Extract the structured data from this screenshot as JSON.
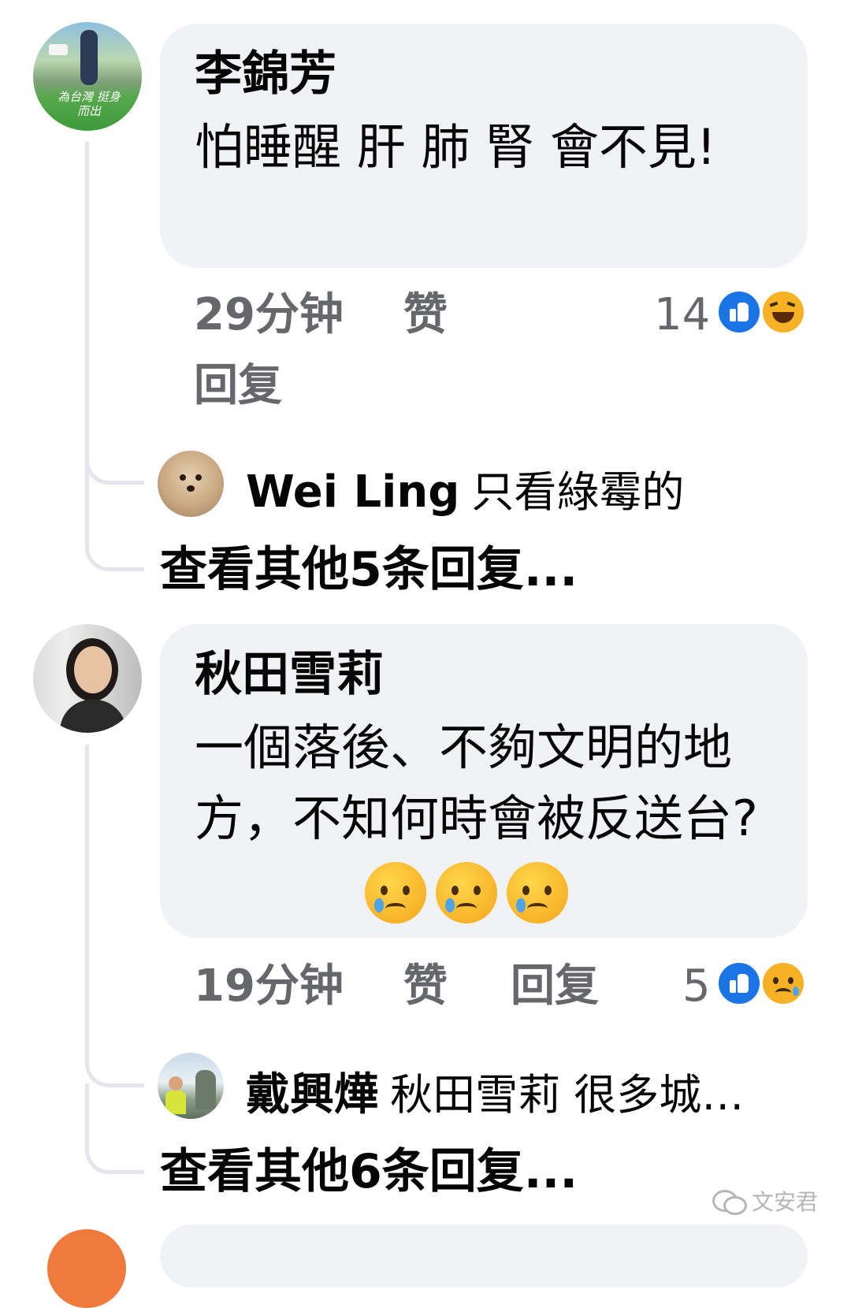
{
  "comments": [
    {
      "author": "李錦芳",
      "text": "怕睡醒 肝 肺 腎 會不見!",
      "time": "29分钟",
      "like_label": "赞",
      "reply_label": "回复",
      "reaction_count": "14",
      "reactions": [
        "like-icon",
        "haha-icon"
      ],
      "avatar_text": "為台灣 挺身而出",
      "reply_preview": {
        "author": "Wei Ling",
        "text": "只看綠霉的"
      },
      "view_more": "查看其他5条回复..."
    },
    {
      "author": "秋田雪莉",
      "text": "一個落後、不夠文明的地方，不知何時會被反送台?",
      "time": "19分钟",
      "like_label": "赞",
      "reply_label": "回复",
      "reaction_count": "5",
      "reactions": [
        "like-icon",
        "sad-icon"
      ],
      "reply_preview": {
        "author": "戴興燁",
        "text": "秋田雪莉 很多城…"
      },
      "view_more": "查看其他6条回复..."
    }
  ],
  "watermark": "文安君"
}
